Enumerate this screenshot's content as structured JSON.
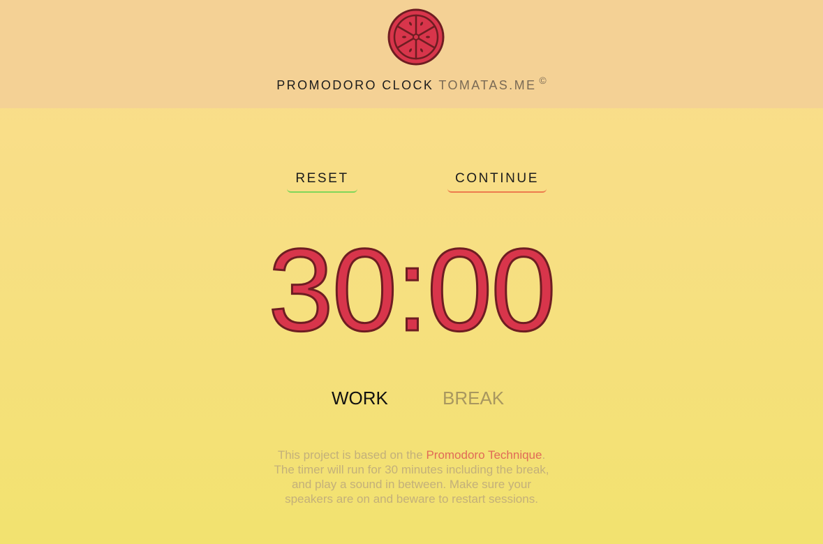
{
  "header": {
    "logo_icon": "tomato-slice-icon",
    "title": "PROMODORO CLOCK",
    "site": "TOMATAS.ME",
    "copyright": "©"
  },
  "controls": {
    "reset_label": "RESET",
    "continue_label": "CONTINUE"
  },
  "timer": {
    "display": "30:00"
  },
  "modes": {
    "work_label": "WORK",
    "break_label": "BREAK",
    "active": "WORK"
  },
  "info": {
    "line1_prefix": "This project is based on the ",
    "link_text": "Promodoro Technique",
    "line1_suffix": ".",
    "line2": "The timer will run for 30 minutes including the break,",
    "line3": "and play a sound in between. Make sure your",
    "line4": "speakers are on and beware to restart sessions."
  },
  "colors": {
    "header_bg": "#f4d195",
    "timer_fill": "#d8354b",
    "timer_outline": "#6e1d22",
    "reset_underline": "#7fd65a",
    "continue_underline": "#ec7b4d",
    "link": "#e06a57"
  }
}
